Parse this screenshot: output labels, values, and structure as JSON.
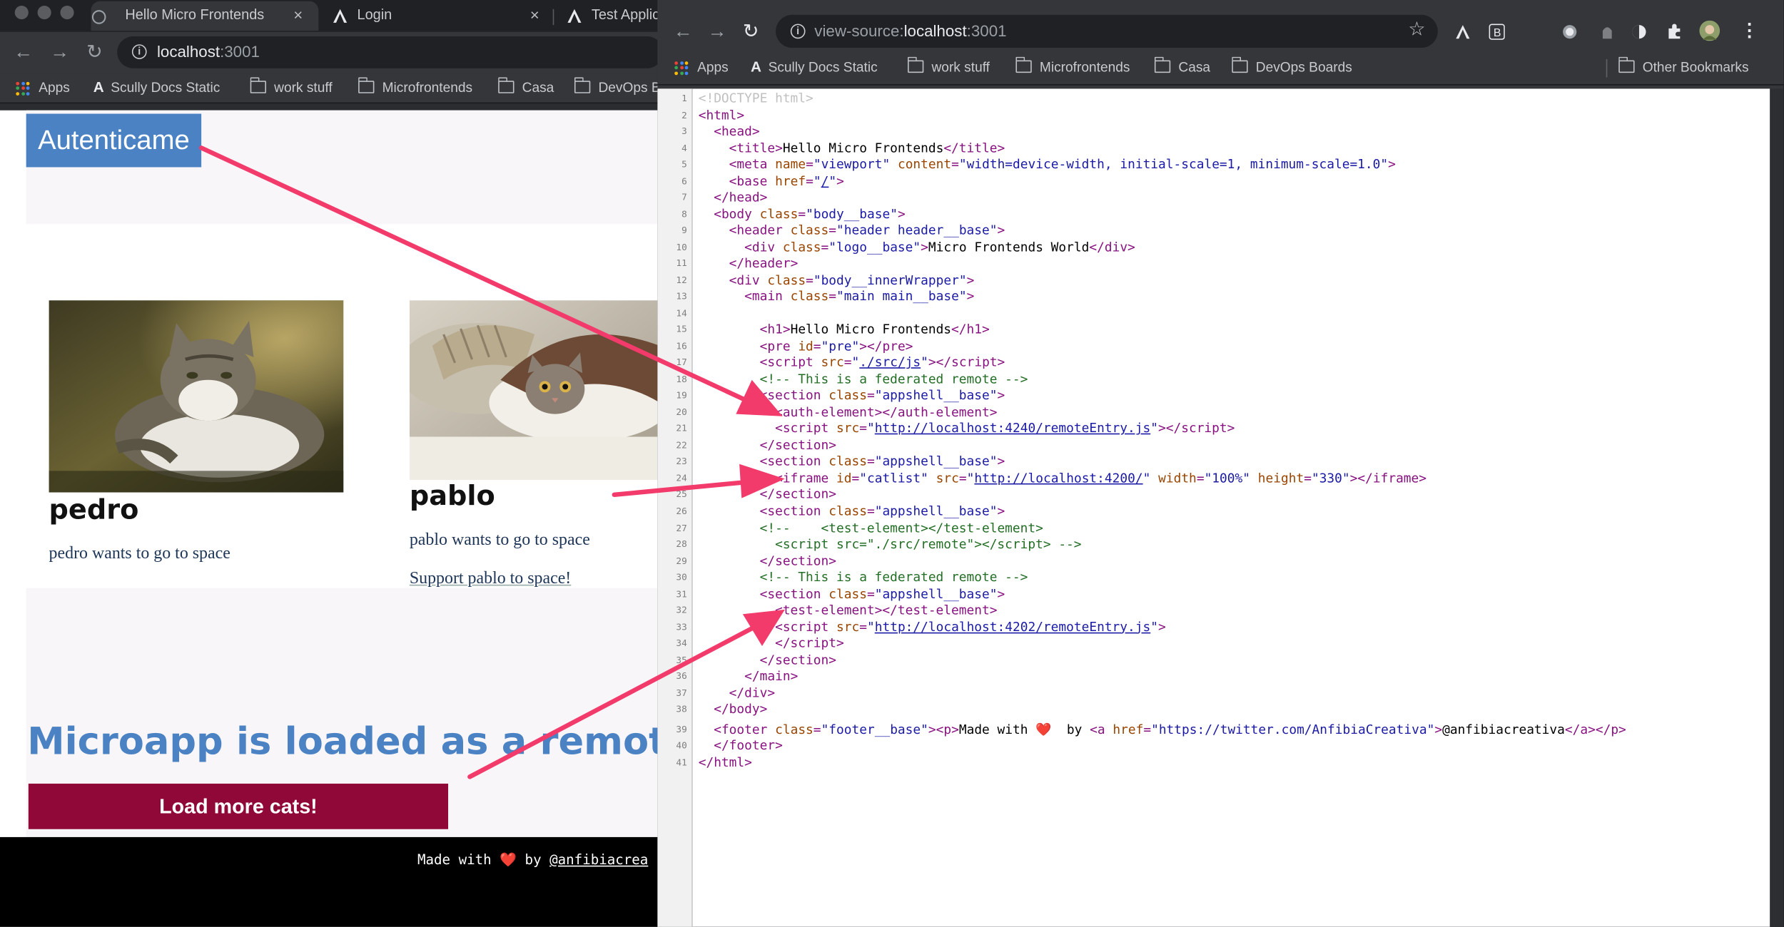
{
  "left_window": {
    "tabs": [
      {
        "title": "Hello Micro Frontends",
        "close": "×"
      },
      {
        "title": "Login",
        "close": "×"
      },
      {
        "title": "Test Applic"
      }
    ],
    "url_host": "localhost",
    "url_port": ":3001",
    "bookmarks": [
      "Apps",
      "Scully Docs Static",
      "work stuff",
      "Microfrontends",
      "Casa",
      "DevOps B"
    ],
    "page": {
      "auth_button": "Autenticame",
      "cats": [
        {
          "name": "pedro",
          "desc": "pedro wants to go to space"
        },
        {
          "name": "pablo",
          "desc": "pablo wants to go to space",
          "link": "Support pablo to space!"
        }
      ],
      "microapp_heading": "Microapp is loaded as a remote",
      "load_button": "Load more cats!",
      "footer_made": "Made with",
      "footer_by": "by",
      "footer_handle": "@anfibiacrea"
    }
  },
  "right_window": {
    "url_prefix": "view-source:",
    "url_host": "localhost",
    "url_port": ":3001",
    "bookmarks": [
      "Apps",
      "Scully Docs Static",
      "work stuff",
      "Microfrontends",
      "Casa",
      "DevOps Boards"
    ],
    "other_bookmarks": "Other Bookmarks",
    "source_lines": [
      {
        "n": "1",
        "html": "<span class=\"dt\">&lt;!DOCTYPE html&gt;</span>"
      },
      {
        "n": "2",
        "html": "<span class=\"t\">&lt;html&gt;</span>"
      },
      {
        "n": "3",
        "html": "  <span class=\"t\">&lt;head&gt;</span>"
      },
      {
        "n": "4",
        "html": "    <span class=\"t\">&lt;title&gt;</span>Hello Micro Frontends<span class=\"t\">&lt;/title&gt;</span>"
      },
      {
        "n": "5",
        "html": "    <span class=\"t\">&lt;meta </span><span class=\"a\">name</span><span class=\"t\">=</span><span class=\"v\">\"viewport\"</span> <span class=\"a\">content</span><span class=\"t\">=</span><span class=\"v\">\"width=device-width, initial-scale=1, minimum-scale=1.0\"</span><span class=\"t\">&gt;</span>"
      },
      {
        "n": "6",
        "html": "    <span class=\"t\">&lt;base </span><span class=\"a\">href</span><span class=\"t\">=</span><span class=\"v\">\"<span class=\"k\">/</span>\"</span><span class=\"t\">&gt;</span>"
      },
      {
        "n": "7",
        "html": "  <span class=\"t\">&lt;/head&gt;</span>"
      },
      {
        "n": "8",
        "html": "  <span class=\"t\">&lt;body </span><span class=\"a\">class</span><span class=\"t\">=</span><span class=\"v\">\"body__base\"</span><span class=\"t\">&gt;</span>"
      },
      {
        "n": "9",
        "html": "    <span class=\"t\">&lt;header </span><span class=\"a\">class</span><span class=\"t\">=</span><span class=\"v\">\"header header__base\"</span><span class=\"t\">&gt;</span>"
      },
      {
        "n": "10",
        "html": "      <span class=\"t\">&lt;div </span><span class=\"a\">class</span><span class=\"t\">=</span><span class=\"v\">\"logo__base\"</span><span class=\"t\">&gt;</span>Micro Frontends World<span class=\"t\">&lt;/div&gt;</span>"
      },
      {
        "n": "11",
        "html": "    <span class=\"t\">&lt;/header&gt;</span>"
      },
      {
        "n": "12",
        "html": "    <span class=\"t\">&lt;div </span><span class=\"a\">class</span><span class=\"t\">=</span><span class=\"v\">\"body__innerWrapper\"</span><span class=\"t\">&gt;</span>"
      },
      {
        "n": "13",
        "html": "      <span class=\"t\">&lt;main </span><span class=\"a\">class</span><span class=\"t\">=</span><span class=\"v\">\"main main__base\"</span><span class=\"t\">&gt;</span>"
      },
      {
        "n": "14",
        "html": ""
      },
      {
        "n": "15",
        "html": "        <span class=\"t\">&lt;h1&gt;</span>Hello Micro Frontends<span class=\"t\">&lt;/h1&gt;</span>"
      },
      {
        "n": "16",
        "html": "        <span class=\"t\">&lt;pre </span><span class=\"a\">id</span><span class=\"t\">=</span><span class=\"v\">\"pre\"</span><span class=\"t\">&gt;&lt;/pre&gt;</span>"
      },
      {
        "n": "17",
        "html": "        <span class=\"t\">&lt;script </span><span class=\"a\">src</span><span class=\"t\">=</span><span class=\"v\">\"<span class=\"k\">./src/js</span>\"</span><span class=\"t\">&gt;&lt;/script&gt;</span>"
      },
      {
        "n": "18",
        "html": "        <span class=\"c\">&lt;!-- This is a federated remote --&gt;</span>"
      },
      {
        "n": "19",
        "html": "        <span class=\"t\">&lt;section </span><span class=\"a\">class</span><span class=\"t\">=</span><span class=\"v\">\"appshell__base\"</span><span class=\"t\">&gt;</span>"
      },
      {
        "n": "20",
        "html": "          <span class=\"t\">&lt;auth-element&gt;&lt;/auth-element&gt;</span>"
      },
      {
        "n": "21",
        "html": "          <span class=\"t\">&lt;script </span><span class=\"a\">src</span><span class=\"t\">=</span><span class=\"v\">\"<span class=\"k\">http://localhost:4240/remoteEntry.js</span>\"</span><span class=\"t\">&gt;&lt;/script&gt;</span>"
      },
      {
        "n": "22",
        "html": "        <span class=\"t\">&lt;/section&gt;</span>"
      },
      {
        "n": "23",
        "html": "        <span class=\"t\">&lt;section </span><span class=\"a\">class</span><span class=\"t\">=</span><span class=\"v\">\"appshell__base\"</span><span class=\"t\">&gt;</span>"
      },
      {
        "n": "24",
        "html": "          <span class=\"t\">&lt;iframe </span><span class=\"a\">id</span><span class=\"t\">=</span><span class=\"v\">\"catlist\"</span> <span class=\"a\">src</span><span class=\"t\">=</span><span class=\"v\">\"<span class=\"k\">http://localhost:4200/</span>\"</span> <span class=\"a\">width</span><span class=\"t\">=</span><span class=\"v\">\"100%\"</span> <span class=\"a\">height</span><span class=\"t\">=</span><span class=\"v\">\"330\"</span><span class=\"t\">&gt;&lt;/iframe&gt;</span>"
      },
      {
        "n": "25",
        "html": "        <span class=\"t\">&lt;/section&gt;</span>"
      },
      {
        "n": "26",
        "html": "        <span class=\"t\">&lt;section </span><span class=\"a\">class</span><span class=\"t\">=</span><span class=\"v\">\"appshell__base\"</span><span class=\"t\">&gt;</span>"
      },
      {
        "n": "27",
        "html": "        <span class=\"c\">&lt;!--    &lt;test-element&gt;&lt;/test-element&gt;</span>"
      },
      {
        "n": "28",
        "html": "<span class=\"c\">          &lt;script src=\"./src/remote\"&gt;&lt;/script&gt; --&gt;</span>"
      },
      {
        "n": "29",
        "html": "        <span class=\"t\">&lt;/section&gt;</span>"
      },
      {
        "n": "30",
        "html": "        <span class=\"c\">&lt;!-- This is a federated remote --&gt;</span>"
      },
      {
        "n": "31",
        "html": "        <span class=\"t\">&lt;section </span><span class=\"a\">class</span><span class=\"t\">=</span><span class=\"v\">\"appshell__base\"</span><span class=\"t\">&gt;</span>"
      },
      {
        "n": "32",
        "html": "          <span class=\"t\">&lt;test-element&gt;&lt;/test-element&gt;</span>"
      },
      {
        "n": "33",
        "html": "          <span class=\"t\">&lt;script </span><span class=\"a\">src</span><span class=\"t\">=</span><span class=\"v\">\"<span class=\"k\">http://localhost:4202/remoteEntry.js</span>\"</span><span class=\"t\">&gt;</span>"
      },
      {
        "n": "34",
        "html": "          <span class=\"t\">&lt;/script&gt;</span>"
      },
      {
        "n": "35",
        "html": "        <span class=\"t\">&lt;/section&gt;</span>"
      },
      {
        "n": "36",
        "html": "      <span class=\"t\">&lt;/main&gt;</span>"
      },
      {
        "n": "37",
        "html": "    <span class=\"t\">&lt;/div&gt;</span>"
      },
      {
        "n": "38",
        "html": "  <span class=\"t\">&lt;/body&gt;</span>"
      },
      {
        "n": "39",
        "html": "  <span class=\"t\">&lt;footer </span><span class=\"a\">class</span><span class=\"t\">=</span><span class=\"v\">\"footer__base\"</span><span class=\"t\">&gt;&lt;p&gt;</span>Made with <span class=\"heart\">❤️</span>  by <span class=\"t\">&lt;a </span><span class=\"a\">href</span><span class=\"t\">=</span><span class=\"v\">\"https://twitter.com/AnfibiaCreativa\"</span><span class=\"t\">&gt;</span>@anfibiacreativa<span class=\"t\">&lt;/a&gt;&lt;/p&gt;</span>"
      },
      {
        "n": "40",
        "html": "  <span class=\"t\">&lt;/footer&gt;</span>"
      },
      {
        "n": "41",
        "html": "<span class=\"t\">&lt;/html&gt;</span>"
      }
    ]
  },
  "colors": {
    "arrow": "#f23a6b",
    "accent_blue": "#4b82c3",
    "button_maroon": "#8f0837"
  },
  "icons": [
    "back-arrow-icon",
    "forward-arrow-icon",
    "reload-icon",
    "info-icon",
    "star-icon",
    "apps-grid-icon",
    "folder-icon",
    "angular-icon",
    "extensions-icon",
    "menu-icon",
    "heart-icon"
  ]
}
